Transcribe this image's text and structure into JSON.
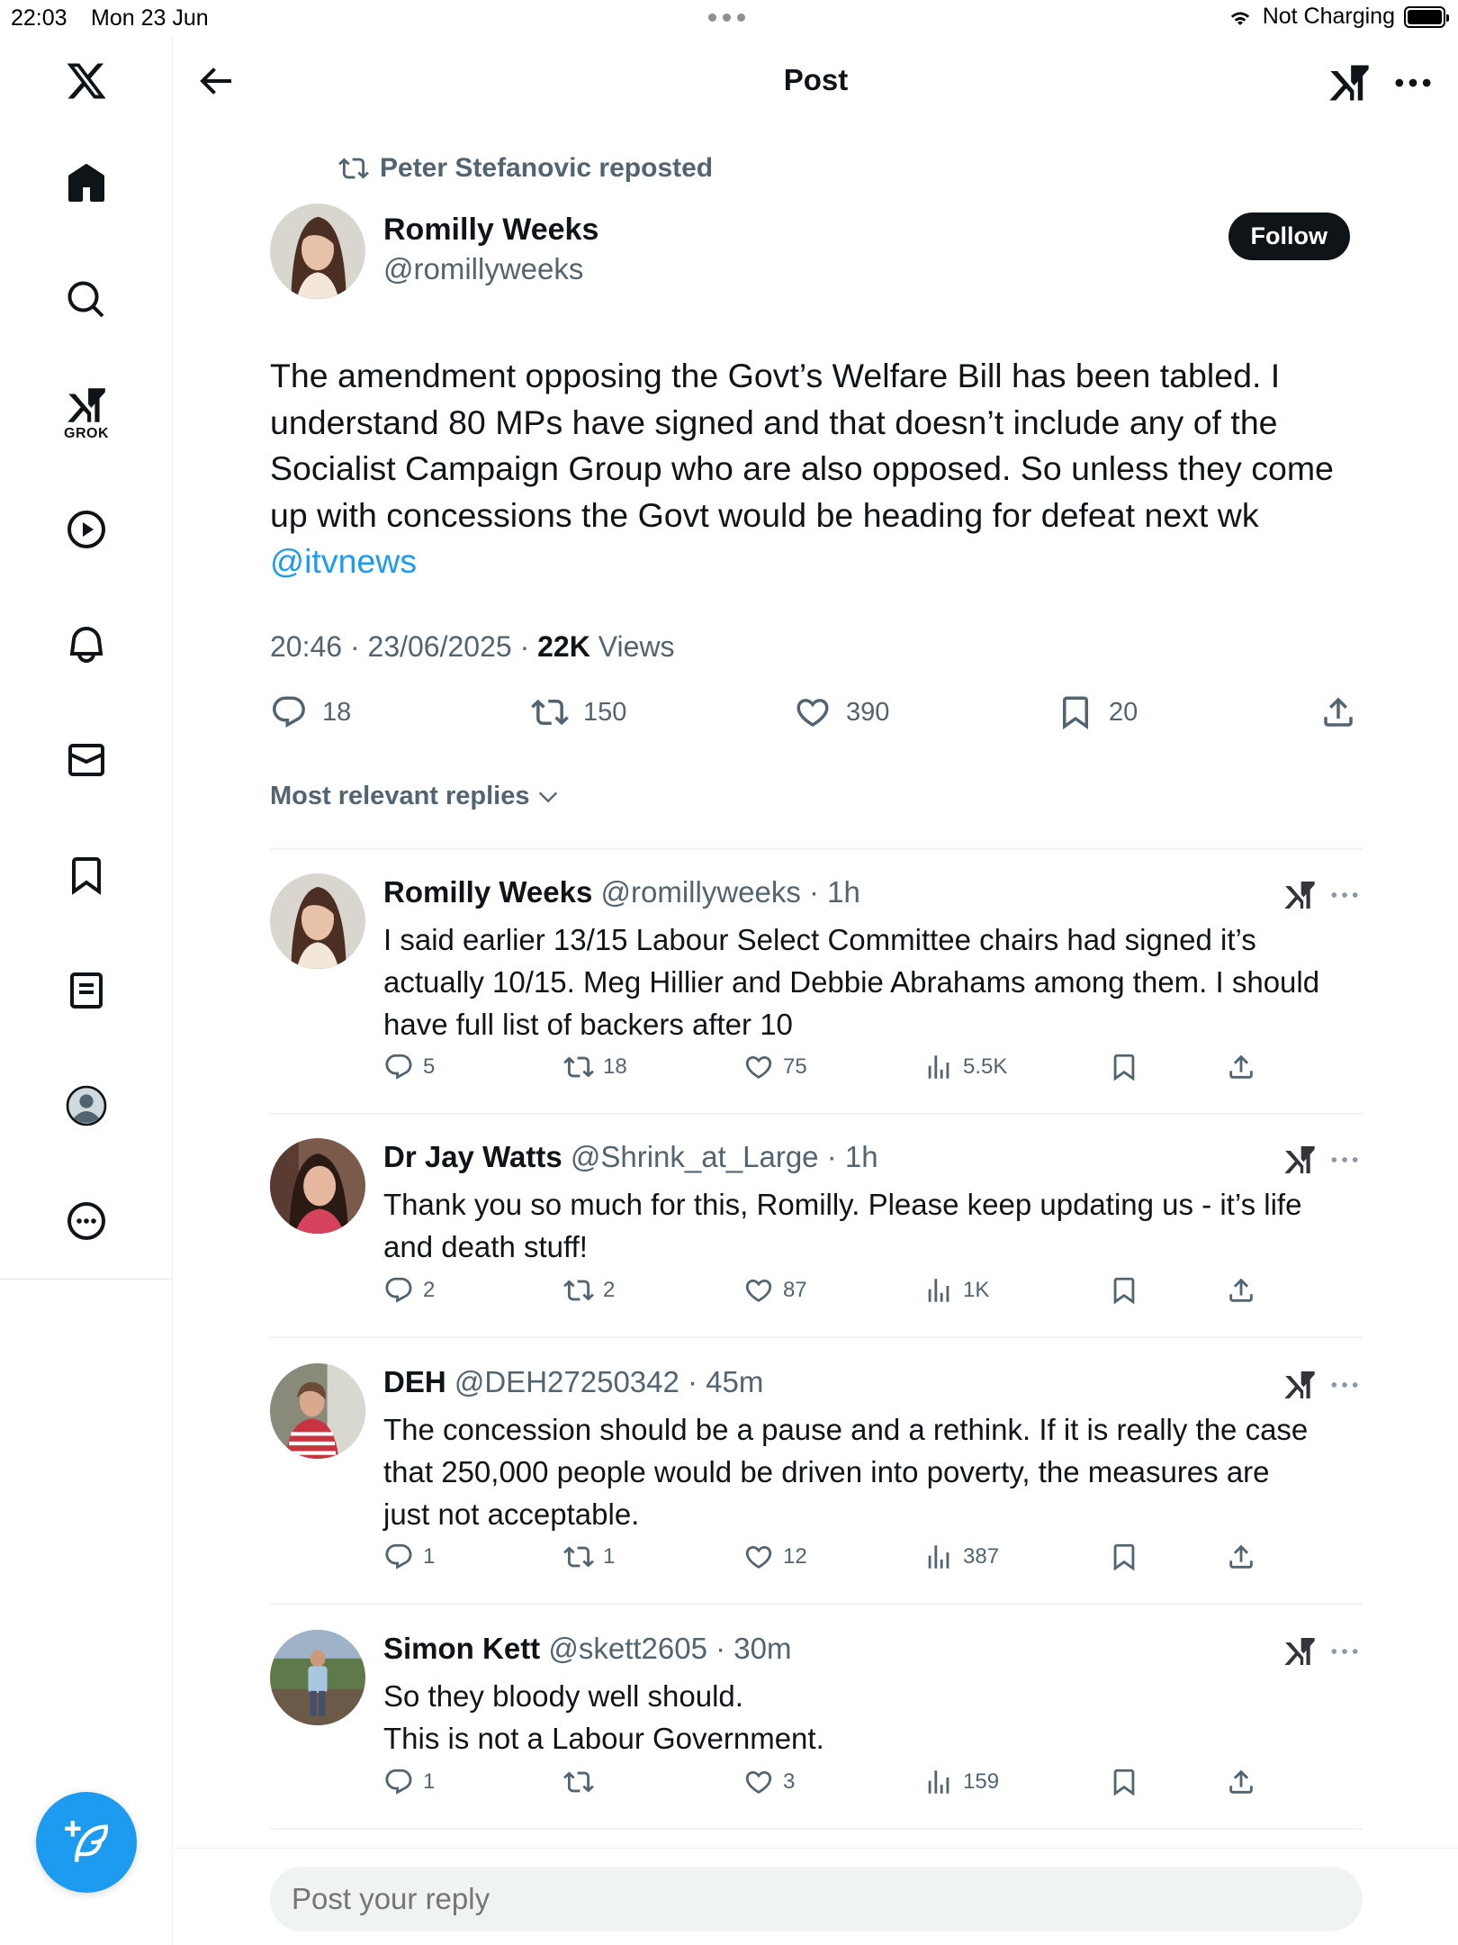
{
  "status_bar": {
    "time": "22:03",
    "date": "Mon 23 Jun",
    "charging": "Not Charging"
  },
  "header": {
    "title": "Post"
  },
  "sidebar": {
    "grok_label": "GROK",
    "items": [
      "home",
      "explore",
      "grok",
      "videos",
      "notifications",
      "messages",
      "bookmarks",
      "lists",
      "profile",
      "more"
    ]
  },
  "post": {
    "repost_text": "Peter Stefanovic reposted",
    "author_name": "Romilly Weeks",
    "author_handle": "@romillyweeks",
    "follow_label": "Follow",
    "text_lines": [
      "The amendment opposing the Govt’s Welfare Bill has been tabled.  I",
      "understand 80 MPs have signed and that doesn’t include any of the",
      "Socialist Campaign Group who are also opposed.  So unless they come",
      "up with concessions the Govt would be heading for defeat next wk"
    ],
    "mention": "@itvnews",
    "timestamp": "20:46 · 23/06/2025 · ",
    "views_count": "22K",
    "views_label": " Views",
    "replies": "18",
    "reposts": "150",
    "likes": "390",
    "bookmarks": "20"
  },
  "replies_sort_label": "Most relevant replies",
  "replies": [
    {
      "name": "Romilly Weeks",
      "handle": " @romillyweeks · 1h",
      "lines": [
        "I said earlier 13/15 Labour Select Committee chairs had signed it’s",
        "actually 10/15.  Meg Hillier and Debbie Abrahams among them.  I should",
        "have full list of backers after 10"
      ],
      "replies": "5",
      "reposts": "18",
      "likes": "75",
      "views": "5.5K"
    },
    {
      "name": "Dr Jay Watts",
      "handle": " @Shrink_at_Large · 1h",
      "lines": [
        "Thank you so much for this, Romilly. Please keep updating us - it’s life",
        "and death stuff!"
      ],
      "replies": "2",
      "reposts": "2",
      "likes": "87",
      "views": "1K"
    },
    {
      "name": "DEH",
      "handle": " @DEH27250342 · 45m",
      "lines": [
        "The concession should be a pause and a rethink. If it is really the case",
        "that 250,000 people would be driven into poverty, the measures are",
        "just not acceptable."
      ],
      "replies": "1",
      "reposts": "1",
      "likes": "12",
      "views": "387"
    },
    {
      "name": "Simon Kett",
      "handle": " @skett2605 · 30m",
      "lines": [
        "So they bloody well should.",
        "This is not a Labour Government."
      ],
      "replies": "1",
      "reposts": "",
      "likes": "3",
      "views": "159"
    }
  ],
  "composer": {
    "placeholder": "Post your reply"
  },
  "colors": {
    "accent": "#1d9bf0",
    "text": "#0f1419",
    "secondary": "#536471",
    "divider": "#eff3f4"
  }
}
